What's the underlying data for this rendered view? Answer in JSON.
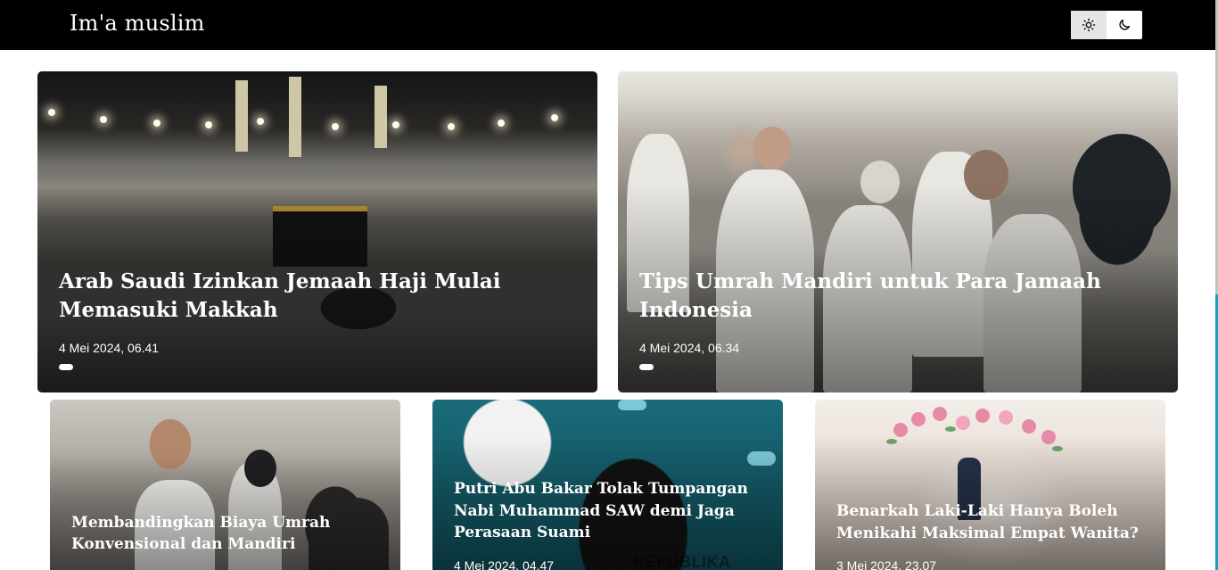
{
  "header": {
    "brand": "Im'a muslim",
    "theme_toggle": {
      "light_icon": "sun-icon",
      "dark_icon": "moon-icon",
      "active": "light"
    }
  },
  "featured": [
    {
      "title": "Arab Saudi Izinkan Jemaah Haji Mulai Memasuki Makkah",
      "date": "4 Mei 2024, 06.41"
    },
    {
      "title": "Tips Umrah Mandiri untuk Para Jamaah Indonesia",
      "date": "4 Mei 2024, 06.34"
    }
  ],
  "articles": [
    {
      "title": "Membandingkan Biaya Umrah Konvensional dan Mandiri"
    },
    {
      "title": "Putri Abu Bakar Tolak Tumpangan Nabi Muhammad SAW demi Jaga Perasaan Suami",
      "date": "4 Mei 2024, 04.47",
      "watermark": "REPUBLIKA"
    },
    {
      "title": "Benarkah Laki-Laki Hanya Boleh Menikahi Maksimal Empat Wanita?",
      "date": "3 Mei 2024, 23.07"
    }
  ],
  "colors": {
    "header_bg": "#000000",
    "accent": "#1ba0b9"
  }
}
